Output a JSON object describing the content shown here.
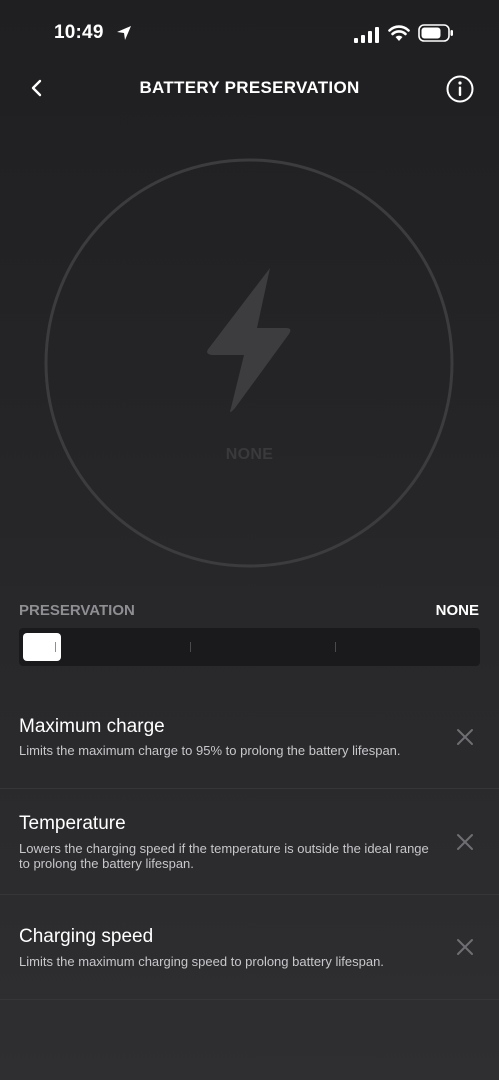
{
  "status_bar": {
    "time": "10:49",
    "icons": [
      "location-arrow-icon",
      "cellular-signal-icon",
      "wifi-icon",
      "battery-icon"
    ]
  },
  "header": {
    "title": "BATTERY PRESERVATION",
    "back_icon": "chevron-left-icon",
    "info_icon": "info-icon"
  },
  "gauge": {
    "icon": "lightning-bolt-icon",
    "label": "NONE"
  },
  "preservation": {
    "label": "PRESERVATION",
    "value": "NONE",
    "level": 0,
    "steps": 4
  },
  "settings": [
    {
      "title": "Maximum charge",
      "description": "Limits the maximum charge to 95% to prolong the battery lifespan."
    },
    {
      "title": "Temperature",
      "description": "Lowers the charging speed if the temperature is outside the ideal range to prolong the battery lifespan."
    },
    {
      "title": "Charging speed",
      "description": "Limits the maximum charging speed to prolong battery lifespan."
    }
  ],
  "colors": {
    "background": "#252527",
    "text_primary": "#ffffff",
    "text_muted": "#8e8e93",
    "gauge_ring": "#3a3a3c",
    "slider_track": "#1a1a1c"
  }
}
